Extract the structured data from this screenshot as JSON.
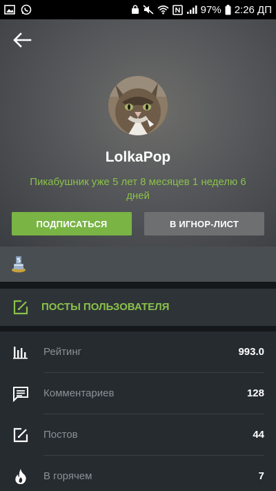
{
  "status_bar": {
    "battery": "97%",
    "time": "2:26 ДП"
  },
  "profile": {
    "username": "LolkaPop",
    "tenure": "Пикабушник уже 5 лет 8 месяцев 1 неделю 6 дней",
    "subscribe_label": "ПОДПИСАТЬСЯ",
    "ignore_label": "В ИГНОР-ЛИСТ"
  },
  "posts_link": {
    "label": "ПОСТЫ ПОЛЬЗОВАТЕЛЯ"
  },
  "stats": [
    {
      "label": "Рейтинг",
      "value": "993.0",
      "icon": "rating-chart-icon"
    },
    {
      "label": "Комментариев",
      "value": "128",
      "icon": "comment-icon"
    },
    {
      "label": "Постов",
      "value": "44",
      "icon": "post-edit-icon"
    },
    {
      "label": "В горячем",
      "value": "7",
      "icon": "flame-icon"
    }
  ],
  "colors": {
    "accent_green": "#8ac249",
    "subscribe_bg": "#79b445",
    "ignore_bg": "#6e6f71",
    "stats_bg": "#262b30"
  }
}
